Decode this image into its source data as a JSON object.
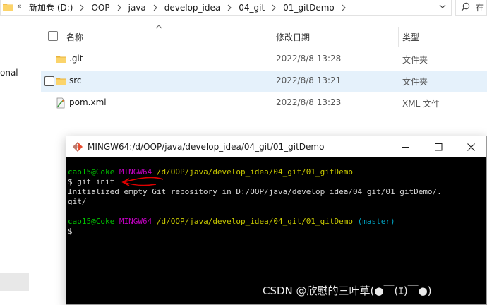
{
  "explorer": {
    "address": {
      "chevrons": "«",
      "crumbs": [
        "新加卷 (D:)",
        "OOP",
        "java",
        "develop_idea",
        "04_git",
        "01_gitDemo"
      ]
    },
    "search_placeholder": "在",
    "nav_fragment": "onal",
    "columns": {
      "name": "名称",
      "modified": "修改日期",
      "type": "类型"
    },
    "files": [
      {
        "name": ".git",
        "modified": "2022/8/8 13:28",
        "type": "文件夹",
        "icon": "folder-icon",
        "selected": false
      },
      {
        "name": "src",
        "modified": "2022/8/8 13:21",
        "type": "文件夹",
        "icon": "folder-icon",
        "selected": true
      },
      {
        "name": "pom.xml",
        "modified": "2022/8/8 13:23",
        "type": "XML 文件",
        "icon": "xml-file-icon",
        "selected": false
      }
    ]
  },
  "terminal": {
    "title": "MINGW64:/d/OOP/java/develop_idea/04_git/01_gitDemo",
    "prompt1": {
      "user": "cao15@Coke",
      "shell": "MINGW64",
      "path": "/d/OOP/java/develop_idea/04_git/01_gitDemo"
    },
    "command": "$ git init",
    "output_line1": "Initialized empty Git repository in D:/OOP/java/develop_idea/04_git/01_gitDemo/.",
    "output_line2": "git/",
    "prompt2": {
      "user": "cao15@Coke",
      "shell": "MINGW64",
      "path": "/d/OOP/java/develop_idea/04_git/01_gitDemo",
      "branch": "(master)"
    },
    "cursor_line": "$",
    "colors": {
      "user": "#00c000",
      "shell": "#c000c0",
      "path": "#c8c800",
      "branch": "#00a8c8",
      "annotation": "#e00000"
    }
  },
  "watermark": "CSDN @欣慰的三叶草(●￣(ｴ)￣●)"
}
